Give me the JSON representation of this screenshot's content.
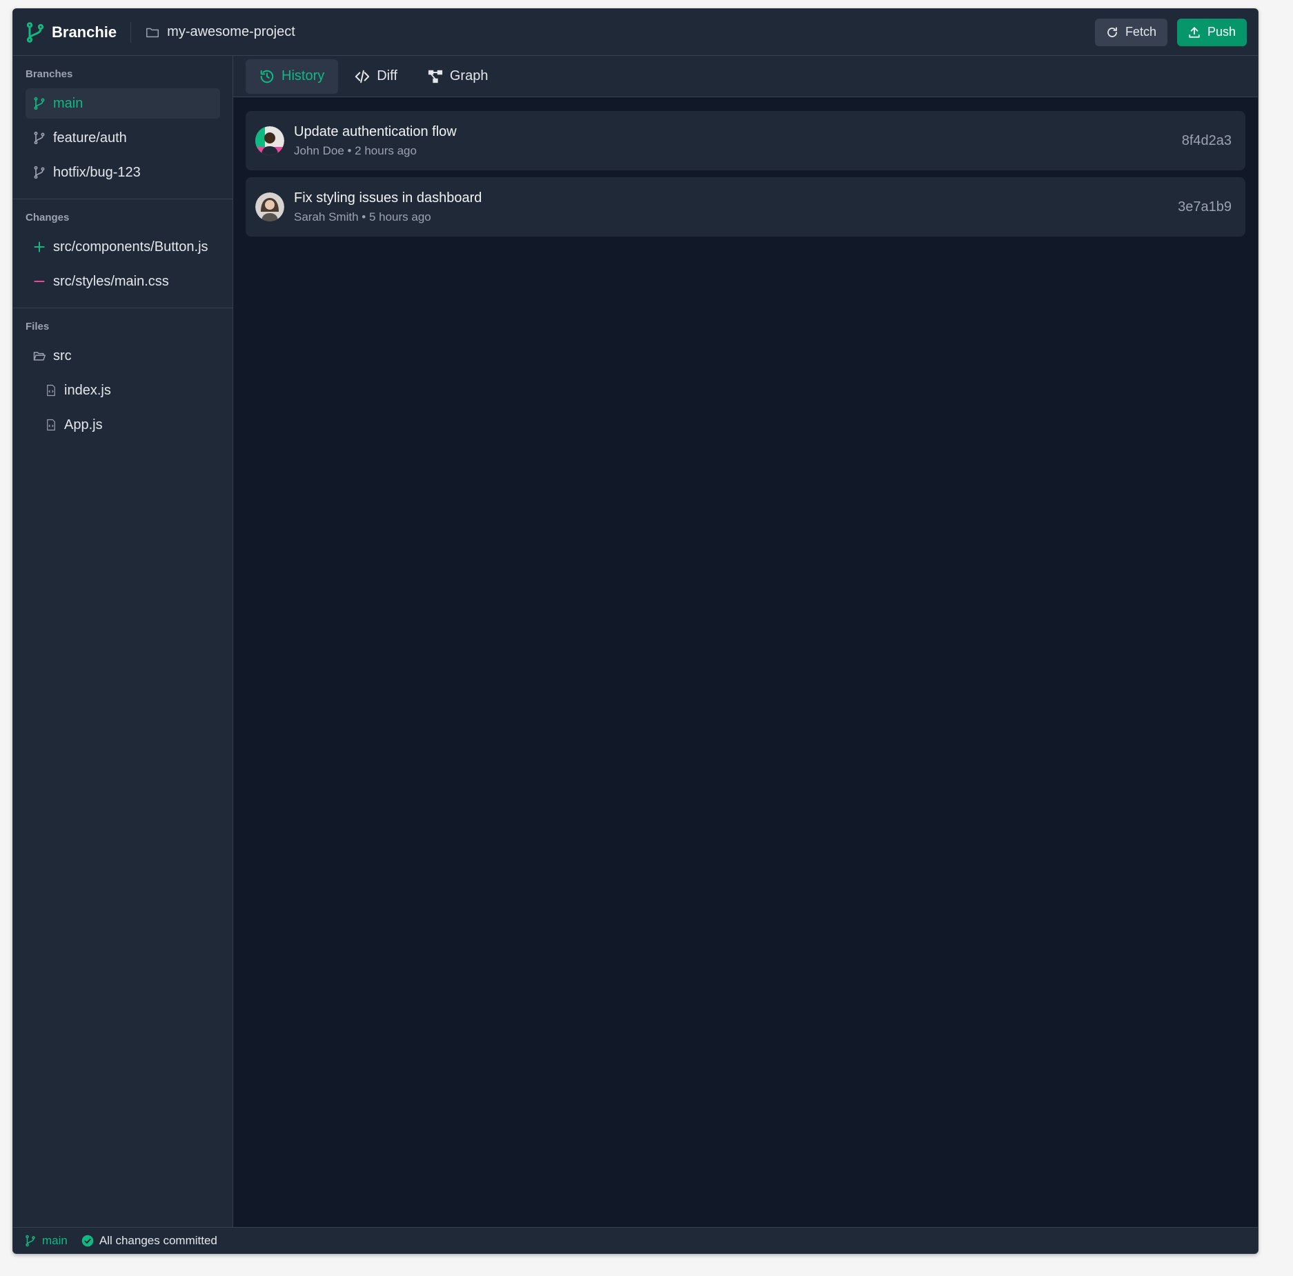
{
  "header": {
    "app_name": "Branchie",
    "project_name": "my-awesome-project",
    "fetch_label": "Fetch",
    "push_label": "Push"
  },
  "sidebar": {
    "branches_title": "Branches",
    "branches": [
      {
        "label": "main",
        "active": true
      },
      {
        "label": "feature/auth",
        "active": false
      },
      {
        "label": "hotfix/bug-123",
        "active": false
      }
    ],
    "changes_title": "Changes",
    "changes": [
      {
        "label": "src/components/Button.js",
        "type": "added"
      },
      {
        "label": "src/styles/main.css",
        "type": "removed"
      }
    ],
    "files_title": "Files",
    "files": [
      {
        "label": "src",
        "kind": "folder"
      },
      {
        "label": "index.js",
        "kind": "file"
      },
      {
        "label": "App.js",
        "kind": "file"
      }
    ]
  },
  "tabs": [
    {
      "label": "History",
      "icon": "history-icon",
      "active": true
    },
    {
      "label": "Diff",
      "icon": "code-icon",
      "active": false
    },
    {
      "label": "Graph",
      "icon": "graph-icon",
      "active": false
    }
  ],
  "commits": [
    {
      "message": "Update authentication flow",
      "meta": "John Doe • 2 hours ago",
      "hash": "8f4d2a3"
    },
    {
      "message": "Fix styling issues in dashboard",
      "meta": "Sarah Smith • 5 hours ago",
      "hash": "3e7a1b9"
    }
  ],
  "status": {
    "branch": "main",
    "message": "All changes committed"
  },
  "colors": {
    "accent": "#10b981",
    "push_button": "#059669",
    "added": "#10b981",
    "removed": "#ec4899",
    "background": "#111827",
    "panel": "#1f2937"
  }
}
